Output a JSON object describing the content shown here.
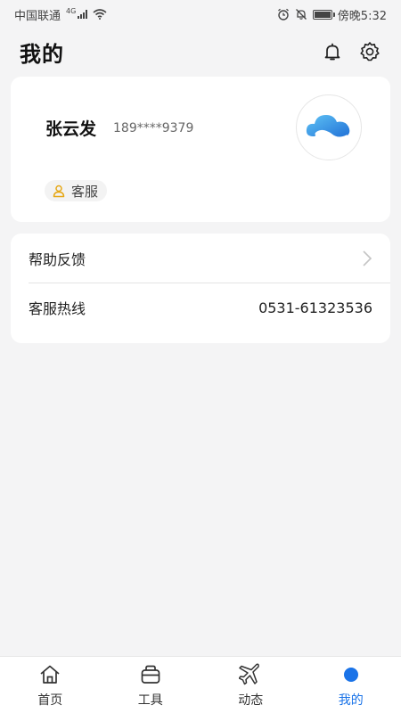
{
  "status_bar": {
    "carrier": "中国联通",
    "network": "4G",
    "time": "傍晚5:32"
  },
  "header": {
    "title": "我的",
    "bell_icon": "bell-icon",
    "settings_icon": "gear-icon"
  },
  "profile": {
    "name": "张云发",
    "phone": "189****9379",
    "role": "客服",
    "avatar_icon": "cloud-logo"
  },
  "menu": {
    "feedback_label": "帮助反馈",
    "hotline_label": "客服热线",
    "hotline_value": "0531-61323536"
  },
  "nav": {
    "items": [
      {
        "label": "首页",
        "icon": "home-icon"
      },
      {
        "label": "工具",
        "icon": "toolbox-icon"
      },
      {
        "label": "动态",
        "icon": "plane-icon"
      },
      {
        "label": "我的",
        "icon": "profile-icon"
      }
    ],
    "active_index": 3
  },
  "colors": {
    "accent": "#1a73e8",
    "background": "#f4f4f5",
    "badge_icon": "#e6a817"
  }
}
